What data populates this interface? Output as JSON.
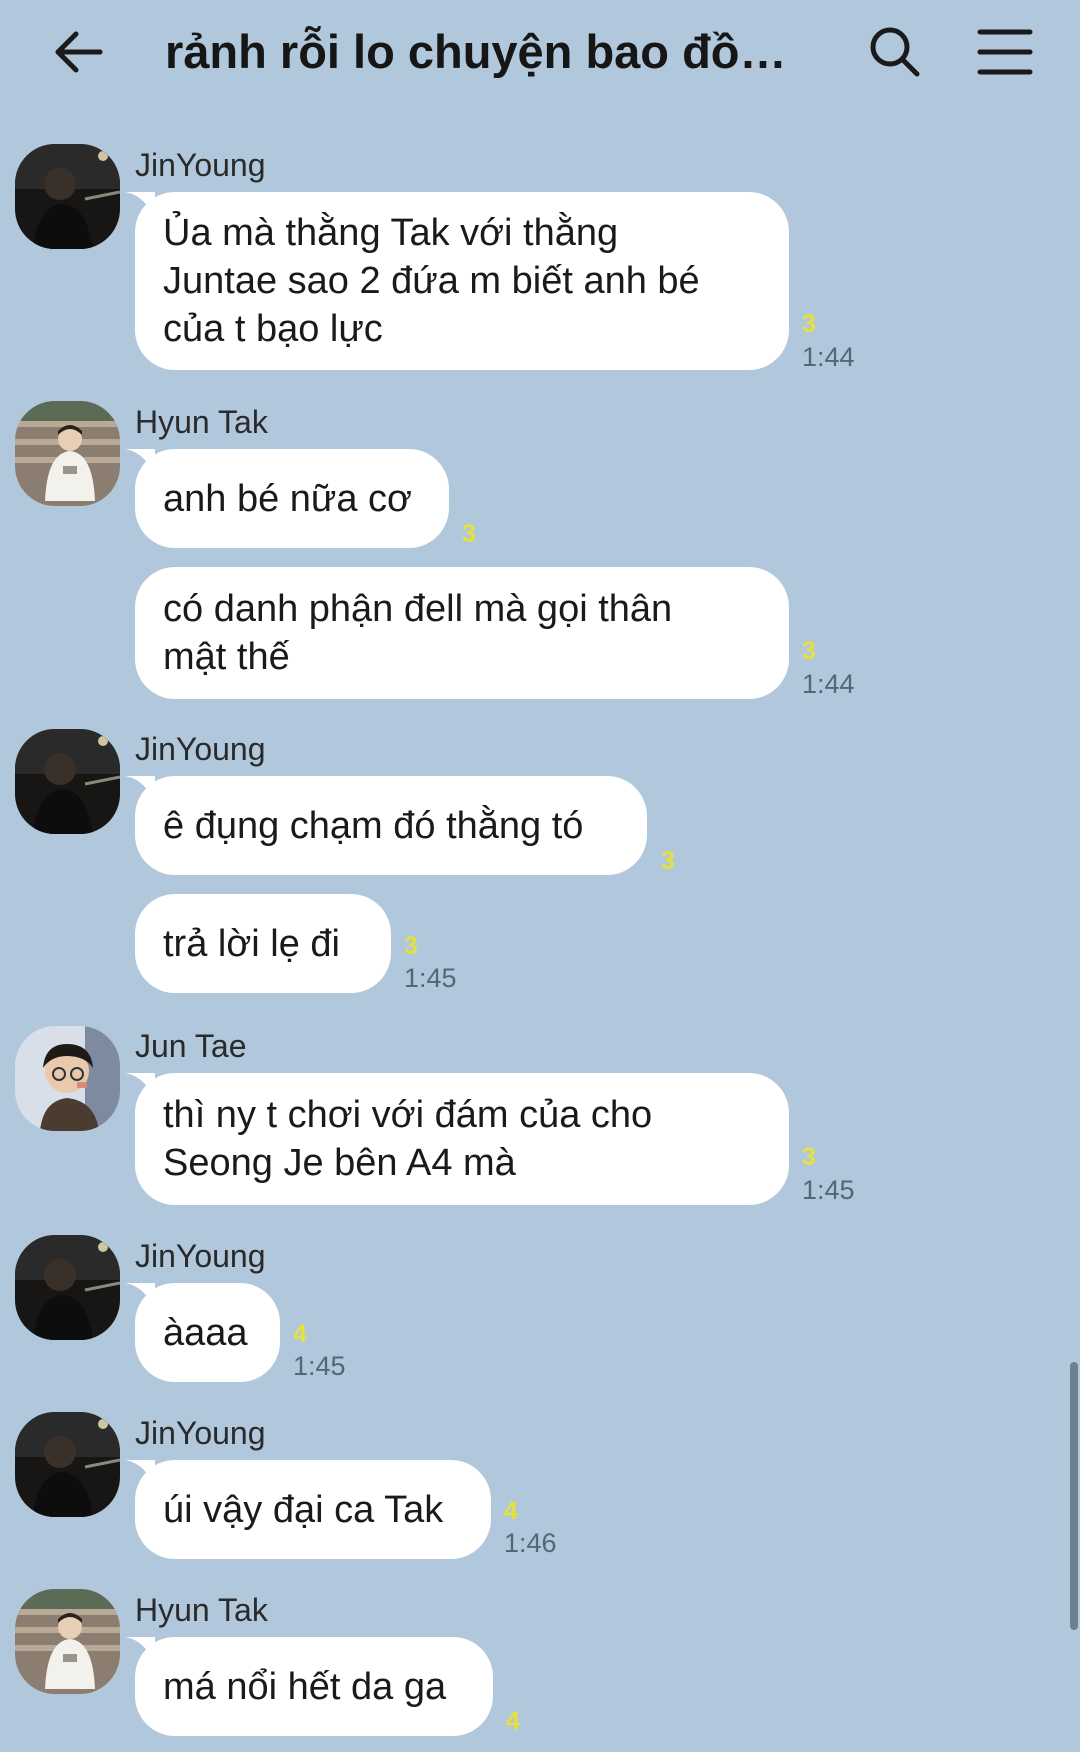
{
  "header": {
    "title": "rảnh rỗi lo chuyện bao đồn...",
    "back_icon": "arrow-left-icon",
    "search_icon": "search-icon",
    "menu_icon": "hamburger-menu-icon"
  },
  "colors": {
    "background": "#b1c7dc",
    "bubble": "#ffffff",
    "unread": "#e6e23a"
  },
  "messages": [
    {
      "sender": "JinYoung",
      "text": "Ủa mà thằng Tak với thằng\nJuntae sao  2 đứa m biết anh bé\ncủa t bạo lực",
      "unread": "3",
      "time": "1:44"
    },
    {
      "sender": "Hyun Tak",
      "text": "anh bé nữa cơ",
      "unread": "3",
      "time": ""
    },
    {
      "sender": "",
      "text": "có danh phận đell mà gọi thân\nmật thế",
      "unread": "3",
      "time": "1:44"
    },
    {
      "sender": "JinYoung",
      "text": "ê đụng chạm đó thằng tó",
      "unread": "3",
      "time": ""
    },
    {
      "sender": "",
      "text": "trả lời lẹ đi",
      "unread": "3",
      "time": "1:45"
    },
    {
      "sender": "Jun Tae",
      "text": "thì ny t chơi với đám của cho\nSeong Je bên A4 mà",
      "unread": "3",
      "time": "1:45"
    },
    {
      "sender": "JinYoung",
      "text": "àaaa",
      "unread": "4",
      "time": "1:45"
    },
    {
      "sender": "JinYoung",
      "text": "úi vậy đại ca Tak",
      "unread": "4",
      "time": "1:46"
    },
    {
      "sender": "Hyun Tak",
      "text": "má nổi hết da ga",
      "unread": "4",
      "time": ""
    }
  ]
}
